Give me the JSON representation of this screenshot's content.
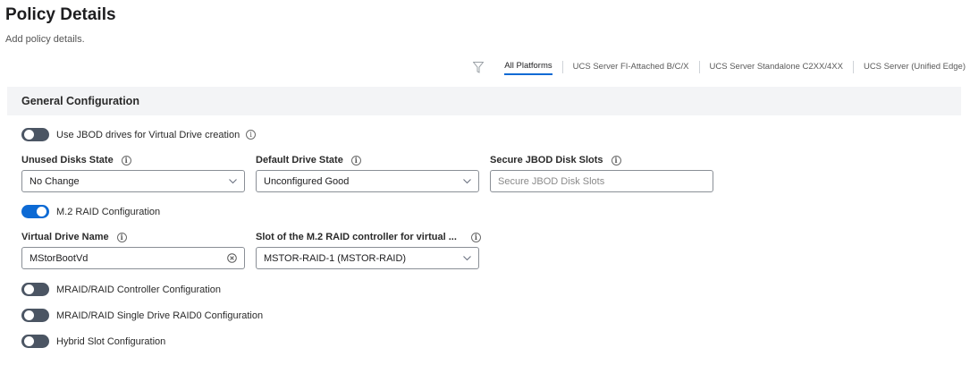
{
  "page": {
    "title": "Policy Details",
    "subtitle": "Add policy details."
  },
  "platforms": {
    "filter_icon": "filter-icon",
    "tabs": [
      {
        "label": "All Platforms",
        "active": true
      },
      {
        "label": "UCS Server FI-Attached B/C/X",
        "active": false
      },
      {
        "label": "UCS Server Standalone C2XX/4XX",
        "active": false
      },
      {
        "label": "UCS Server (Unified Edge)",
        "active": false
      }
    ]
  },
  "section": {
    "title": "General Configuration"
  },
  "jbod_toggle": {
    "label": "Use JBOD drives for Virtual Drive creation",
    "on": false
  },
  "unused_disks": {
    "label": "Unused Disks State",
    "value": "No Change"
  },
  "default_drive": {
    "label": "Default Drive State",
    "value": "Unconfigured Good"
  },
  "secure_jbod": {
    "label": "Secure JBOD Disk Slots",
    "placeholder": "Secure JBOD Disk Slots",
    "value": ""
  },
  "m2_toggle": {
    "label": "M.2 RAID Configuration",
    "on": true
  },
  "virtual_drive": {
    "label": "Virtual Drive Name",
    "value": "MStorBootVd"
  },
  "m2_slot": {
    "label": "Slot of the M.2 RAID controller for virtual ...",
    "value": "MSTOR-RAID-1 (MSTOR-RAID)"
  },
  "mraid_toggle": {
    "label": "MRAID/RAID Controller Configuration",
    "on": false
  },
  "raid0_toggle": {
    "label": "MRAID/RAID Single Drive RAID0 Configuration",
    "on": false
  },
  "hybrid_toggle": {
    "label": "Hybrid Slot Configuration",
    "on": false
  },
  "colors": {
    "accent": "#0d6ad4",
    "toggle_off": "#4b5563",
    "section_bg": "#f3f4f6"
  }
}
